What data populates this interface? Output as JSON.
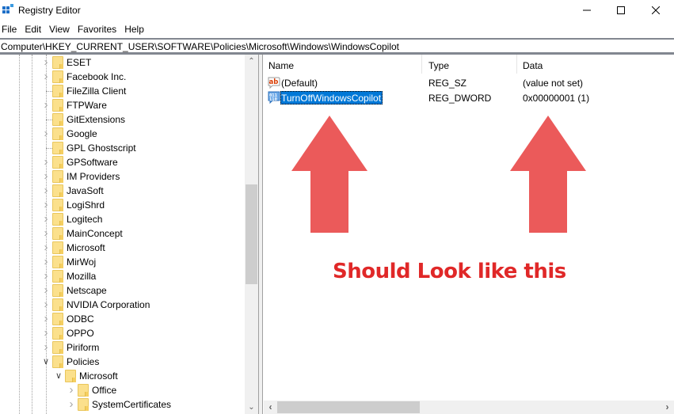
{
  "window": {
    "title": "Registry Editor",
    "icon": "regedit-icon",
    "controls": [
      "minimize",
      "maximize",
      "close"
    ]
  },
  "menu": {
    "items": [
      "File",
      "Edit",
      "View",
      "Favorites",
      "Help"
    ]
  },
  "address": {
    "path": "Computer\\HKEY_CURRENT_USER\\SOFTWARE\\Policies\\Microsoft\\Windows\\WindowsCopilot"
  },
  "tree": {
    "items": [
      {
        "label": "ESET",
        "level": 0,
        "expander": "collapsed"
      },
      {
        "label": "Facebook Inc.",
        "level": 0,
        "expander": "collapsed"
      },
      {
        "label": "FileZilla Client",
        "level": 0,
        "expander": "none"
      },
      {
        "label": "FTPWare",
        "level": 0,
        "expander": "collapsed"
      },
      {
        "label": "GitExtensions",
        "level": 0,
        "expander": "none"
      },
      {
        "label": "Google",
        "level": 0,
        "expander": "collapsed"
      },
      {
        "label": "GPL Ghostscript",
        "level": 0,
        "expander": "none"
      },
      {
        "label": "GPSoftware",
        "level": 0,
        "expander": "collapsed"
      },
      {
        "label": "IM Providers",
        "level": 0,
        "expander": "collapsed"
      },
      {
        "label": "JavaSoft",
        "level": 0,
        "expander": "collapsed"
      },
      {
        "label": "LogiShrd",
        "level": 0,
        "expander": "collapsed"
      },
      {
        "label": "Logitech",
        "level": 0,
        "expander": "collapsed"
      },
      {
        "label": "MainConcept",
        "level": 0,
        "expander": "collapsed"
      },
      {
        "label": "Microsoft",
        "level": 0,
        "expander": "collapsed"
      },
      {
        "label": "MirWoj",
        "level": 0,
        "expander": "collapsed"
      },
      {
        "label": "Mozilla",
        "level": 0,
        "expander": "collapsed"
      },
      {
        "label": "Netscape",
        "level": 0,
        "expander": "collapsed"
      },
      {
        "label": "NVIDIA Corporation",
        "level": 0,
        "expander": "collapsed"
      },
      {
        "label": "ODBC",
        "level": 0,
        "expander": "collapsed"
      },
      {
        "label": "OPPO",
        "level": 0,
        "expander": "collapsed"
      },
      {
        "label": "Piriform",
        "level": 0,
        "expander": "collapsed"
      },
      {
        "label": "Policies",
        "level": 0,
        "expander": "expanded"
      },
      {
        "label": "Microsoft",
        "level": 1,
        "expander": "expanded"
      },
      {
        "label": "Office",
        "level": 2,
        "expander": "collapsed"
      },
      {
        "label": "SystemCertificates",
        "level": 2,
        "expander": "collapsed"
      }
    ]
  },
  "list": {
    "columns": [
      "Name",
      "Type",
      "Data"
    ],
    "rows": [
      {
        "name": "(Default)",
        "type": "REG_SZ",
        "data": "(value not set)",
        "icon": "string-value-icon",
        "selected": false
      },
      {
        "name": "TurnOffWindowsCopilot",
        "type": "REG_DWORD",
        "data": "0x00000001 (1)",
        "icon": "binary-value-icon",
        "selected": true
      }
    ]
  },
  "annotation": {
    "text": "Should Look like this",
    "arrow_color": "#eb5a5a",
    "text_color": "#e02828"
  },
  "colors": {
    "selection": "#0078d7",
    "folder": "#fbe08c"
  }
}
